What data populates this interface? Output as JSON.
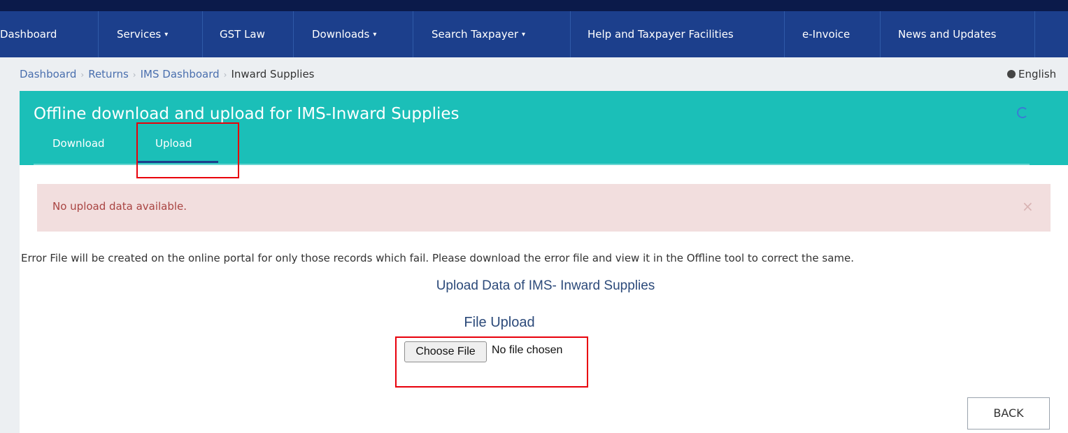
{
  "nav": {
    "items": [
      {
        "label": "Dashboard"
      },
      {
        "label": "Services",
        "caret": "▾"
      },
      {
        "label": "GST Law"
      },
      {
        "label": "Downloads",
        "caret": "▾"
      },
      {
        "label": "Search Taxpayer",
        "caret": "▾"
      },
      {
        "label": "Help and Taxpayer Facilities"
      },
      {
        "label": "e-Invoice"
      },
      {
        "label": "News and Updates"
      }
    ]
  },
  "breadcrumb": {
    "items": [
      "Dashboard",
      "Returns",
      "IMS Dashboard"
    ],
    "current": "Inward Supplies"
  },
  "language": "English",
  "header": {
    "title": "Offline download and upload for IMS-Inward Supplies",
    "tabs": [
      {
        "label": "Download",
        "active": false
      },
      {
        "label": "Upload",
        "active": true
      }
    ]
  },
  "alert": {
    "message": "No upload data available.",
    "close": "×"
  },
  "info_text": "Error File will be created on the online portal for only those records which fail. Please download the error file and view it in the Offline tool to correct the same.",
  "upload": {
    "title": "Upload Data of IMS- Inward Supplies",
    "file_label": "File Upload",
    "choose_button": "Choose File",
    "no_file_text": "No file chosen"
  },
  "back_button": "BACK",
  "colors": {
    "nav_bg": "#1c3f8c",
    "header_teal": "#1bbfb8",
    "alert_bg": "#f2dede",
    "alert_text": "#a94442",
    "highlight": "#e8000b"
  }
}
